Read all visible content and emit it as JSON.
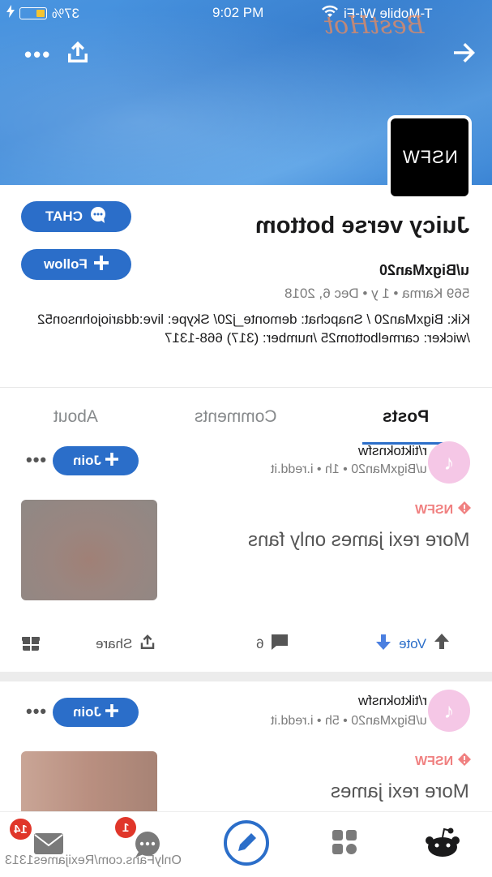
{
  "status_bar": {
    "battery_percent": "37%",
    "time": "9:02 PM",
    "carrier": "T-Mobile Wi-Fi",
    "battery_color": "#f4c431"
  },
  "watermark_top": "BestHot",
  "banner": {
    "avatar_text": "NSFW"
  },
  "profile": {
    "title": "Juicy verse bottom",
    "username": "u/BigxMan20",
    "meta": "569 Karma • 1 y • Dec 6, 2018",
    "bio": "Kik: BigxMan20 / Snapchat: demonte_j20/ Skype: live:ddariojohnson52 /wicker: carmelbottom25 /number: (317) 668-1317",
    "chat_label": "CHAT",
    "follow_label": "Follow",
    "accent": "#2b6ec9"
  },
  "tabs": [
    {
      "label": "Posts",
      "active": true
    },
    {
      "label": "Comments",
      "active": false
    },
    {
      "label": "About",
      "active": false
    }
  ],
  "posts": [
    {
      "subreddit": "r/tiktoknsfw",
      "meta": "u/BigxMan20 • 1h • i.redd.it",
      "join_label": "Join",
      "nsfw_label": "NSFW",
      "title": "More rexi james only fans",
      "vote_label": "Vote",
      "comments": "6",
      "share_label": "Share"
    },
    {
      "subreddit": "r/tiktoknsfw",
      "meta": "u/BigxMan20 • 5h • i.redd.it",
      "join_label": "Join",
      "nsfw_label": "NSFW",
      "title": "More rexi james"
    }
  ],
  "nav": {
    "inbox_badge": "14",
    "chat_badge": "1"
  },
  "watermark_bottom": "OnlyFans.com/Rexijames1313"
}
